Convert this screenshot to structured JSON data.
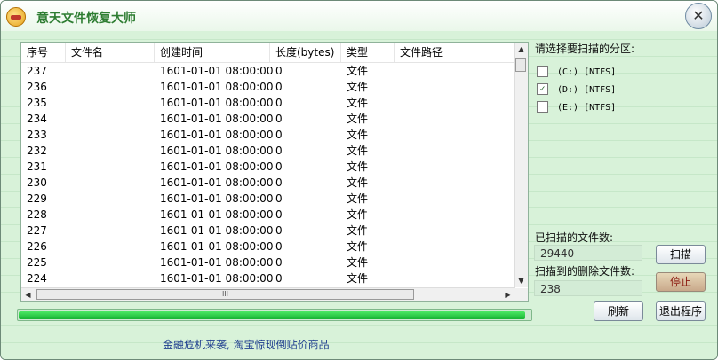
{
  "window": {
    "title": "意天文件恢复大师",
    "close_label": "✕"
  },
  "table": {
    "columns": [
      "序号",
      "文件名",
      "创建时间",
      "长度(bytes)",
      "类型",
      "文件路径"
    ],
    "rows": [
      [
        "237",
        "",
        "1601-01-01 08:00:00",
        "0",
        "文件",
        ""
      ],
      [
        "236",
        "",
        "1601-01-01 08:00:00",
        "0",
        "文件",
        ""
      ],
      [
        "235",
        "",
        "1601-01-01 08:00:00",
        "0",
        "文件",
        ""
      ],
      [
        "234",
        "",
        "1601-01-01 08:00:00",
        "0",
        "文件",
        ""
      ],
      [
        "233",
        "",
        "1601-01-01 08:00:00",
        "0",
        "文件",
        ""
      ],
      [
        "232",
        "",
        "1601-01-01 08:00:00",
        "0",
        "文件",
        ""
      ],
      [
        "231",
        "",
        "1601-01-01 08:00:00",
        "0",
        "文件",
        ""
      ],
      [
        "230",
        "",
        "1601-01-01 08:00:00",
        "0",
        "文件",
        ""
      ],
      [
        "229",
        "",
        "1601-01-01 08:00:00",
        "0",
        "文件",
        ""
      ],
      [
        "228",
        "",
        "1601-01-01 08:00:00",
        "0",
        "文件",
        ""
      ],
      [
        "227",
        "",
        "1601-01-01 08:00:00",
        "0",
        "文件",
        ""
      ],
      [
        "226",
        "",
        "1601-01-01 08:00:00",
        "0",
        "文件",
        ""
      ],
      [
        "225",
        "",
        "1601-01-01 08:00:00",
        "0",
        "文件",
        ""
      ],
      [
        "224",
        "",
        "1601-01-01 08:00:00",
        "0",
        "文件",
        ""
      ]
    ]
  },
  "partitions": {
    "label": "请选择要扫描的分区:",
    "items": [
      {
        "label": "(C:) [NTFS]",
        "checked": false
      },
      {
        "label": "(D:) [NTFS]",
        "checked": true
      },
      {
        "label": "(E:) [NTFS]",
        "checked": false
      }
    ]
  },
  "scanned": {
    "label": "已扫描的文件数:",
    "value": "29440"
  },
  "deleted": {
    "label": "扫描到的删除文件数:",
    "value": "238"
  },
  "buttons": {
    "scan": "扫描",
    "stop": "停止",
    "refresh": "刷新",
    "exit": "退出程序"
  },
  "progress": {
    "fraction": 0.99
  },
  "ad": {
    "text": "金融危机来袭, 淘宝惊现倒贴价商品"
  },
  "scroll": {
    "h_thumb_glyph": "III"
  }
}
